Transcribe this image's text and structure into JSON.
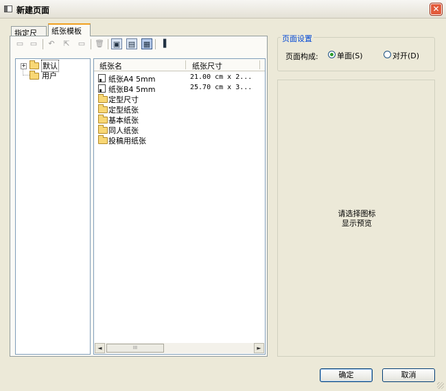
{
  "window": {
    "title": "新建页面",
    "close_glyph": "✕"
  },
  "tabs": [
    {
      "label": "指定尺寸"
    },
    {
      "label": "纸张模板"
    }
  ],
  "toolbar": {
    "buttons": [
      {
        "name": "new-folder-icon",
        "glyph": "▭",
        "enabled": false
      },
      {
        "name": "copy-folder-icon",
        "glyph": "▭",
        "enabled": false
      },
      {
        "name": "undo-icon",
        "glyph": "↶",
        "enabled": false
      },
      {
        "name": "move-icon",
        "glyph": "⇱",
        "enabled": false
      },
      {
        "name": "rename-icon",
        "glyph": "▭",
        "enabled": false
      },
      {
        "name": "delete-icon",
        "glyph": "🗑",
        "enabled": false
      },
      {
        "name": "large-icons-view-icon",
        "glyph": "▣",
        "enabled": true
      },
      {
        "name": "small-icons-view-icon",
        "glyph": "▤",
        "enabled": true
      },
      {
        "name": "details-view-icon",
        "glyph": "▦",
        "enabled": true,
        "pressed": true
      },
      {
        "name": "panel-toggle-icon",
        "glyph": "▐",
        "enabled": true
      }
    ]
  },
  "tree": {
    "expand_glyph": "+",
    "items": [
      {
        "label": "默认"
      },
      {
        "label": "用户"
      }
    ]
  },
  "list": {
    "columns": [
      "纸张名",
      "纸张尺寸"
    ],
    "rows": [
      {
        "type": "file",
        "name": "纸张A4 5mm",
        "size": "21.00 cm x 2..."
      },
      {
        "type": "file",
        "name": "纸张B4 5mm",
        "size": "25.70 cm x 3..."
      },
      {
        "type": "folder",
        "name": "定型尺寸",
        "size": ""
      },
      {
        "type": "folder",
        "name": "定型纸张",
        "size": ""
      },
      {
        "type": "folder",
        "name": "基本纸张",
        "size": ""
      },
      {
        "type": "folder",
        "name": "同人纸张",
        "size": ""
      },
      {
        "type": "folder",
        "name": "投稿用纸张",
        "size": ""
      }
    ],
    "scroll_left": "◄",
    "scroll_right": "►",
    "thumb_grip": "III"
  },
  "page_settings": {
    "group_title": "页面设置",
    "layout_label": "页面构成:",
    "options": [
      {
        "label": "单面(S)",
        "checked": true
      },
      {
        "label": "对开(D)",
        "checked": false
      }
    ]
  },
  "preview": {
    "line1": "请选择图标",
    "line2": "显示预览"
  },
  "buttons": {
    "ok": "确定",
    "cancel": "取消"
  }
}
